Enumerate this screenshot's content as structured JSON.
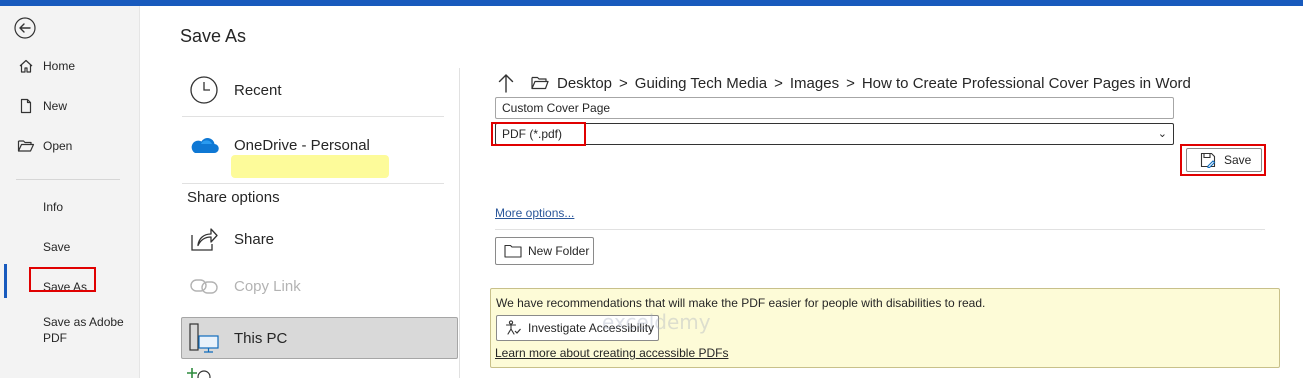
{
  "page": {
    "title": "Save As"
  },
  "nav": {
    "home": "Home",
    "new": "New",
    "open": "Open",
    "info": "Info",
    "save": "Save",
    "save_as": "Save As",
    "save_as_adobe_pdf": "Save as Adobe PDF"
  },
  "locations": {
    "recent": "Recent",
    "onedrive": "OneDrive - Personal",
    "share_options": "Share options",
    "share": "Share",
    "copy_link": "Copy Link",
    "this_pc": "This PC"
  },
  "path": {
    "crumbs": [
      "Desktop",
      "Guiding Tech Media",
      "Images",
      "How to Create Professional Cover Pages in Word"
    ],
    "separator": ">"
  },
  "form": {
    "filename": "Custom Cover Page",
    "filetype": "PDF (*.pdf)",
    "save_label": "Save",
    "more_options": "More options...",
    "new_folder": "New Folder"
  },
  "recommendation": {
    "text": "We have recommendations that will make the PDF easier for people with disabilities to read.",
    "button": "Investigate Accessibility",
    "learn_more": "Learn more about creating accessible PDFs"
  },
  "watermark": "exceldemy",
  "colors": {
    "accent": "#185abd",
    "highlight_box": "#e00000",
    "banner_bg": "#fdfbd7",
    "link": "#2b579a"
  }
}
